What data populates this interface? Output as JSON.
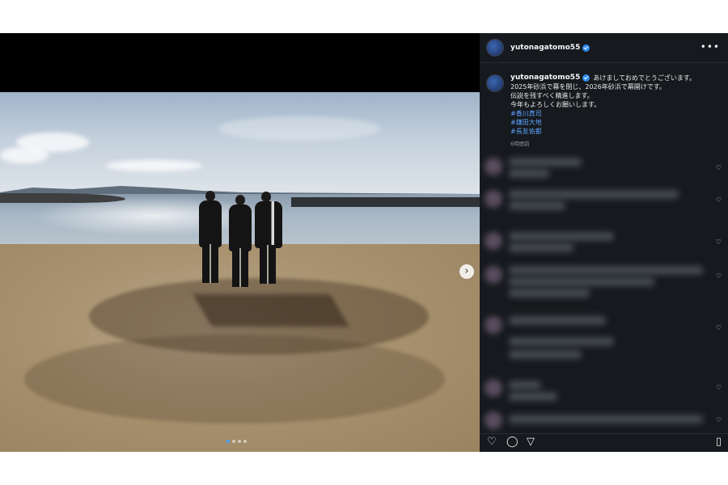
{
  "post": {
    "username": "yutonagatomo55",
    "more_label": "•••",
    "caption_lines": [
      "あけましておめでとうございます。",
      "2025年砂浜で幕を閉じ、2026年砂浜で幕開けです。",
      "伝説を残すべく精進します。",
      "今年もよろしくお願いします。"
    ],
    "hashtags": [
      "#香川真司",
      "#鎌田大地",
      "#長友佑都"
    ],
    "time_ago": "6時間前"
  },
  "carousel": {
    "next_icon": "chevron-right-icon",
    "next_glyph": "›",
    "dot_count": 4,
    "active_dot": 0
  },
  "actions": {
    "like_icon": "heart-icon",
    "comment_icon": "comment-icon",
    "share_icon": "send-icon",
    "save_icon": "bookmark-icon",
    "like_glyph": "♡",
    "comment_glyph": "◯",
    "share_glyph": "▽",
    "save_glyph": "▯"
  },
  "comment_heart_glyph": "♡",
  "colors": {
    "panel_bg": "#16191d",
    "hashtag": "#5da3ff",
    "verified": "#2f8cf0"
  }
}
